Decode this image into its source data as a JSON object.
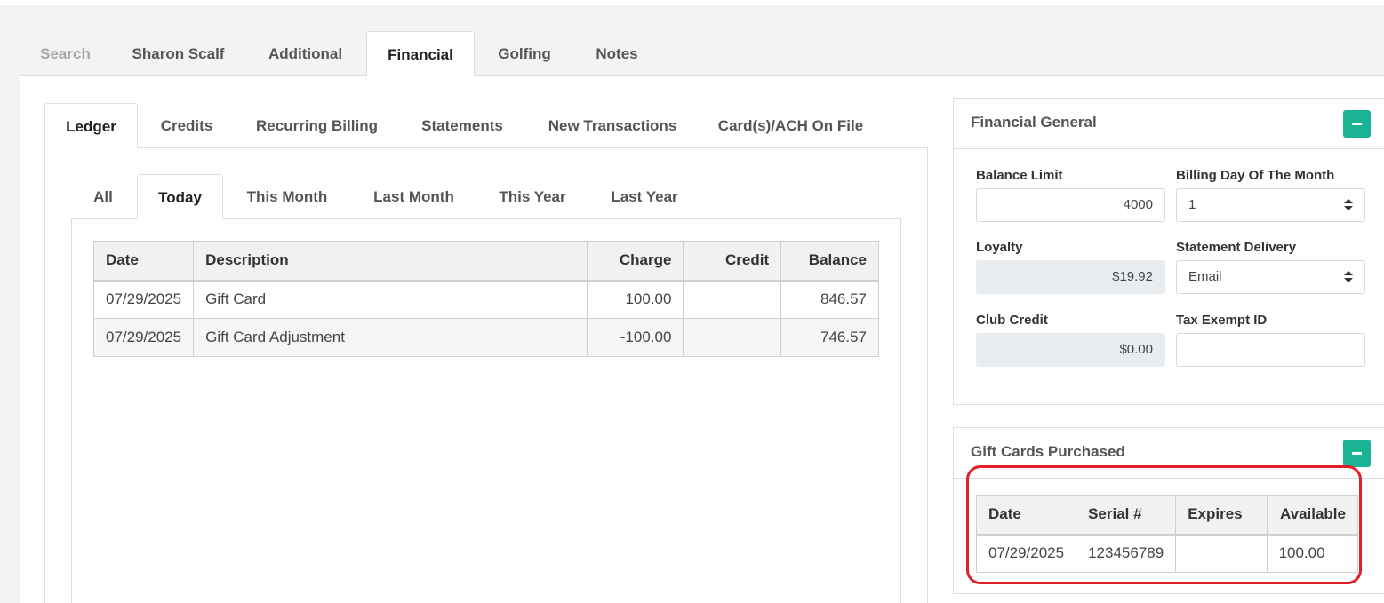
{
  "top_tabs": [
    {
      "label": "Search"
    },
    {
      "label": "Sharon Scalf"
    },
    {
      "label": "Additional"
    },
    {
      "label": "Financial"
    },
    {
      "label": "Golfing"
    },
    {
      "label": "Notes"
    }
  ],
  "ledger_tabs": [
    {
      "label": "Ledger"
    },
    {
      "label": "Credits"
    },
    {
      "label": "Recurring Billing"
    },
    {
      "label": "Statements"
    },
    {
      "label": "New Transactions"
    },
    {
      "label": "Card(s)/ACH On File"
    }
  ],
  "range_tabs": [
    {
      "label": "All"
    },
    {
      "label": "Today"
    },
    {
      "label": "This Month"
    },
    {
      "label": "Last Month"
    },
    {
      "label": "This Year"
    },
    {
      "label": "Last Year"
    }
  ],
  "ledger_table": {
    "headers": [
      "Date",
      "Description",
      "Charge",
      "Credit",
      "Balance"
    ],
    "rows": [
      {
        "date": "07/29/2025",
        "description": "Gift Card",
        "charge": "100.00",
        "credit": "",
        "balance": "846.57"
      },
      {
        "date": "07/29/2025",
        "description": "Gift Card Adjustment",
        "charge": "-100.00",
        "credit": "",
        "balance": "746.57"
      }
    ]
  },
  "financial_general": {
    "title": "Financial General",
    "balance_limit_label": "Balance Limit",
    "balance_limit_value": "4000",
    "billing_day_label": "Billing Day Of The Month",
    "billing_day_value": "1",
    "loyalty_label": "Loyalty",
    "loyalty_value": "$19.92",
    "statement_delivery_label": "Statement Delivery",
    "statement_delivery_value": "Email",
    "club_credit_label": "Club Credit",
    "club_credit_value": "$0.00",
    "tax_exempt_label": "Tax Exempt ID",
    "tax_exempt_value": ""
  },
  "gift_cards": {
    "title": "Gift Cards Purchased",
    "headers": [
      "Date",
      "Serial #",
      "Expires",
      "Available"
    ],
    "rows": [
      {
        "date": "07/29/2025",
        "serial": "123456789",
        "expires": "",
        "available": "100.00"
      }
    ]
  },
  "colors": {
    "accent": "#1ab394",
    "highlight": "#e01f26"
  }
}
